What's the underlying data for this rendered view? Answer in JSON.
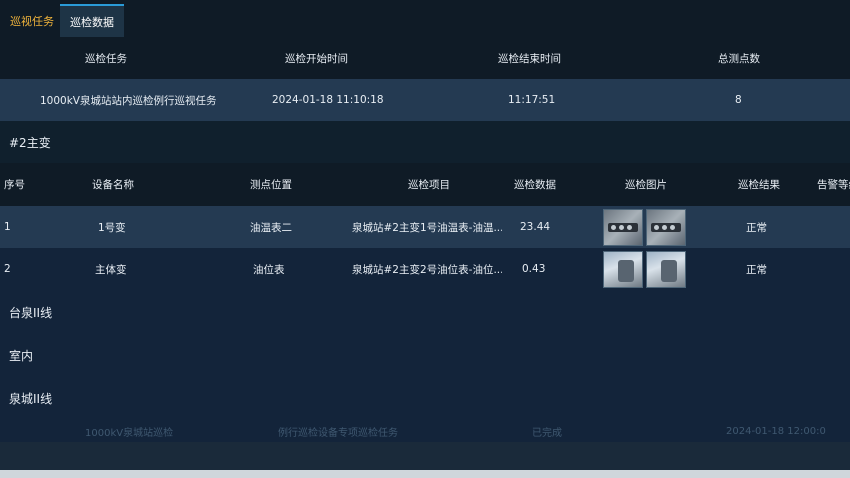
{
  "tabs": [
    {
      "label": "巡视任务"
    },
    {
      "label": "巡检数据"
    }
  ],
  "task_table": {
    "headers": [
      "巡检任务",
      "巡检开始时间",
      "巡检结束时间",
      "总测点数"
    ],
    "rows": [
      [
        "1000kV泉城站站内巡检例行巡视任务",
        "2024-01-18 11:10:18",
        "11:17:51",
        "8"
      ]
    ]
  },
  "group1": {
    "label": "#2主变"
  },
  "detail_table": {
    "headers": [
      "序号",
      "设备名称",
      "测点位置",
      "巡检项目",
      "巡检数据",
      "巡检图片",
      "巡检结果",
      "告警等级"
    ],
    "rows": [
      [
        "1",
        "1号变",
        "油温表二",
        "泉城站#2主变1号油温表-油温...",
        "23.44",
        "",
        "正常",
        ""
      ],
      [
        "2",
        "主体变",
        "油位表",
        "泉城站#2主变2号油位表-油位...",
        "0.43",
        "",
        "正常",
        ""
      ]
    ]
  },
  "groups": [
    {
      "label": "台泉II线"
    },
    {
      "label": "室内"
    },
    {
      "label": "泉城II线"
    }
  ],
  "faded_row": [
    "1000kV泉城站巡检",
    "例行巡检设备专项巡检任务",
    "已完成",
    "2024-01-18 12:00:00"
  ]
}
